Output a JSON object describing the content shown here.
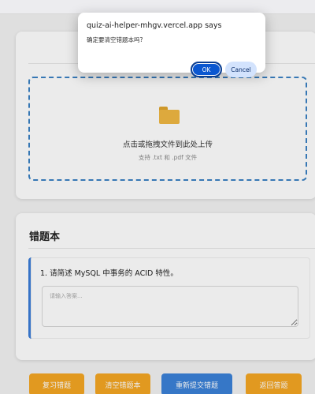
{
  "dialog": {
    "title": "quiz-ai-helper-mhgv.vercel.app says",
    "message": "确定要清空错题本吗?",
    "ok_label": "OK",
    "cancel_label": "Cancel"
  },
  "upload": {
    "main_text": "点击或拖拽文件到此处上传",
    "hint_text": "支持 .txt 和 .pdf 文件",
    "icon": "folder-icon"
  },
  "wrong_book": {
    "title": "错题本",
    "questions": [
      {
        "text": "1. 请简述 MySQL 中事务的 ACID 特性。",
        "answer_placeholder": "请输入答案..."
      }
    ]
  },
  "actions": {
    "review_label": "复习错题",
    "clear_label": "清空错题本",
    "resubmit_label": "重新提交错题",
    "back_label": "返回答题"
  },
  "colors": {
    "primary_blue": "#3b82d8",
    "warning_orange": "#f5a623",
    "dialog_ok": "#0b57d0",
    "dialog_cancel": "#d3e3fd"
  }
}
